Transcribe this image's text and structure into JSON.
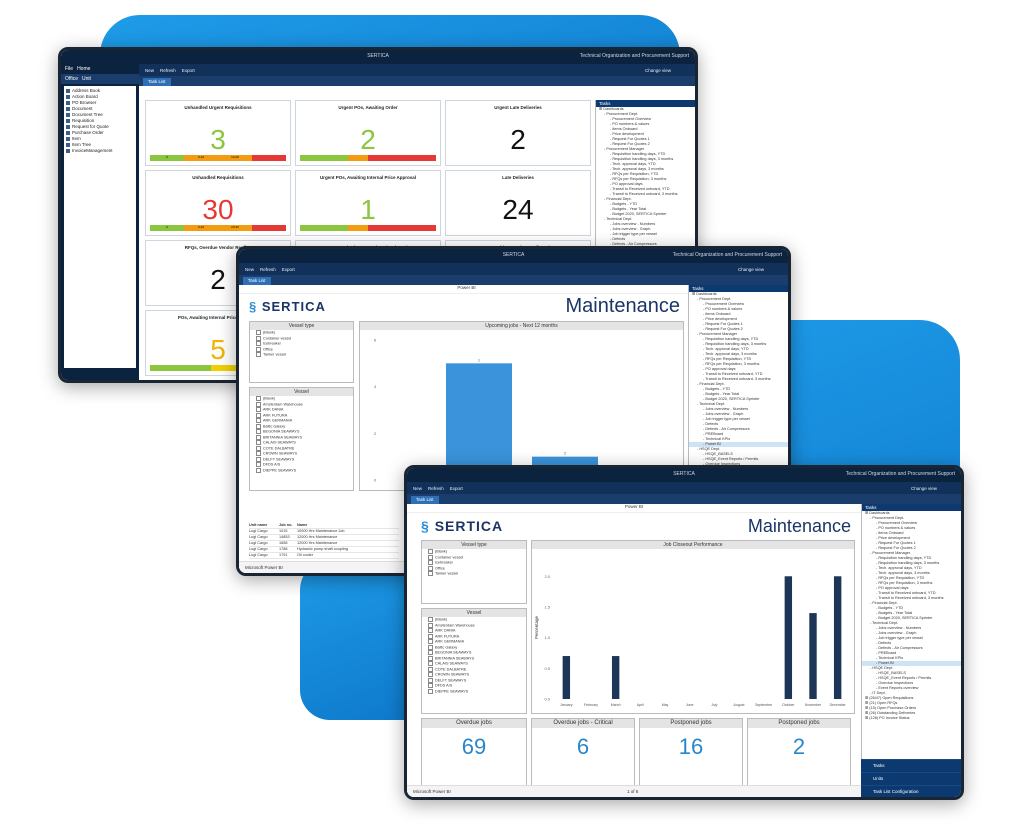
{
  "app_title": "SERTICA",
  "org_name": "Technical Organization and Procurement Support",
  "change_view": "Change view",
  "colors": {
    "dark_navy": "#0c2340",
    "accent_blue": "#2a86c9",
    "bar_navy": "#1d3557",
    "green": "#8cc63f",
    "orange": "#f39c12",
    "red": "#e53935"
  },
  "toolbar": {
    "new": "New",
    "refresh": "Refresh",
    "export": "Export"
  },
  "tab_label": "Task List",
  "w1": {
    "file_tab": "File",
    "home_tab": "Home",
    "office_tab": "Office",
    "unit_tab": "Unit",
    "nav_items": [
      "Address Book",
      "Action Board",
      "PO Browser",
      "Document",
      "Document Tree",
      "Requisition",
      "Request for Quote",
      "Purchase Order",
      "Item",
      "Item Tree",
      "InvoiceManagement"
    ],
    "cards": [
      {
        "title": "Unhandled Urgent Requisitions",
        "value": "3",
        "color": "#8cc63f",
        "bar": [
          {
            "color": "#8cc63f",
            "w": 25,
            "label": "0"
          },
          {
            "color": "#f39c12",
            "w": 25,
            "label": "0-10"
          },
          {
            "color": "#f39c12",
            "w": 25,
            "label": "10-20"
          },
          {
            "color": "#e53935",
            "w": 25,
            "label": ""
          }
        ]
      },
      {
        "title": "Urgent POs, Awaiting Order",
        "value": "2",
        "color": "#8cc63f",
        "bar": [
          {
            "color": "#8cc63f",
            "w": 35,
            "label": ""
          },
          {
            "color": "#f39c12",
            "w": 15,
            "label": ""
          },
          {
            "color": "#e53935",
            "w": 50,
            "label": ""
          }
        ]
      },
      {
        "title": "Urgent Late Deliveries",
        "value": "2",
        "color": "#111111",
        "bar": []
      },
      {
        "title": "Unhandled Requisitions",
        "value": "30",
        "color": "#e53935",
        "bar": [
          {
            "color": "#8cc63f",
            "w": 25,
            "label": "0"
          },
          {
            "color": "#f39c12",
            "w": 25,
            "label": "0-20"
          },
          {
            "color": "#f39c12",
            "w": 25,
            "label": "20-30"
          },
          {
            "color": "#e53935",
            "w": 25,
            "label": ""
          }
        ]
      },
      {
        "title": "Urgent POs, Awaiting Internal Price Approval",
        "value": "1",
        "color": "#8cc63f",
        "bar": [
          {
            "color": "#8cc63f",
            "w": 35,
            "label": ""
          },
          {
            "color": "#f39c12",
            "w": 15,
            "label": ""
          },
          {
            "color": "#e53935",
            "w": 50,
            "label": ""
          }
        ]
      },
      {
        "title": "Late Deliveries",
        "value": "24",
        "color": "#111111",
        "bar": []
      },
      {
        "title": "RFQs, Overdue Vendor Replies",
        "value": "2",
        "color": "#111111",
        "bar": []
      },
      {
        "title": "POs, Ordred - Not Recieved Onboard",
        "value": "",
        "color": "#111111",
        "bar": []
      },
      {
        "title": "POs Awaiting Vendor Confirmation",
        "value": "",
        "color": "#111111",
        "bar": []
      },
      {
        "title": "POs, Awaiting Internal Price Approval",
        "value": "5",
        "color": "#f0b400",
        "bar": [
          {
            "color": "#8cc63f",
            "w": 45,
            "label": ""
          },
          {
            "color": "#f0d000",
            "w": 20,
            "label": ""
          },
          {
            "color": "#e53935",
            "w": 35,
            "label": ""
          }
        ]
      }
    ]
  },
  "tasks": {
    "header": "Tasks",
    "items": [
      {
        "t": "Dashboards",
        "l": 0
      },
      {
        "t": "Procurement Dept.",
        "l": 1
      },
      {
        "t": "Procurement Overview",
        "l": 2
      },
      {
        "t": "PO numbers & values",
        "l": 2
      },
      {
        "t": "Items Onboard",
        "l": 2
      },
      {
        "t": "Price development",
        "l": 2
      },
      {
        "t": "Request For Quotes 1",
        "l": 2
      },
      {
        "t": "Request For Quotes 2",
        "l": 2
      },
      {
        "t": "Procurement Manager",
        "l": 1
      },
      {
        "t": "Requisition handling days, YTD",
        "l": 2
      },
      {
        "t": "Requisition handling days, 3 months",
        "l": 2
      },
      {
        "t": "Tech. approval days, YTD",
        "l": 2
      },
      {
        "t": "Tech. approval days, 3 months",
        "l": 2
      },
      {
        "t": "RFQs per Requisition, YTD",
        "l": 2
      },
      {
        "t": "RFQs per Requisition, 3 months",
        "l": 2
      },
      {
        "t": "PO approval days",
        "l": 2
      },
      {
        "t": "Transit to Received onboard, YTD",
        "l": 2
      },
      {
        "t": "Transit to Received onboard, 3 months",
        "l": 2
      },
      {
        "t": "Financial Dept.",
        "l": 1
      },
      {
        "t": "Budgets - YTD",
        "l": 2
      },
      {
        "t": "Budgets - Year Total",
        "l": 2
      },
      {
        "t": "Budget 2020, SERTICA Sprinter",
        "l": 2
      },
      {
        "t": "Technical Dept.",
        "l": 1
      },
      {
        "t": "Jobs overview - Numbers",
        "l": 2
      },
      {
        "t": "Jobs overview - Graph",
        "l": 2
      },
      {
        "t": "Job trigger type per vessel",
        "l": 2
      },
      {
        "t": "Defects",
        "l": 2
      },
      {
        "t": "Defects - Air Compressors",
        "l": 2
      },
      {
        "t": "PREBoard",
        "l": 2
      },
      {
        "t": "Technical KPIs",
        "l": 2
      },
      {
        "t": "Power BI",
        "l": 2,
        "sel": true
      },
      {
        "t": "HSQE Dept.",
        "l": 1
      },
      {
        "t": "HSQE_BASELS",
        "l": 2
      },
      {
        "t": "HSQE_Event Reports / Permits",
        "l": 2
      },
      {
        "t": "Overdue Inspections",
        "l": 2
      },
      {
        "t": "Event Reports overview",
        "l": 2
      },
      {
        "t": "IT Dept.",
        "l": 1
      },
      {
        "t": "(26/47) Open Requisitions",
        "l": 0
      },
      {
        "t": "(21) Open RFQs",
        "l": 0
      },
      {
        "t": "(15) Open Purchase Orders",
        "l": 0
      },
      {
        "t": "(26) Outstanding Deliveries",
        "l": 0
      },
      {
        "t": "(128) PO Invoice Status",
        "l": 0
      }
    ]
  },
  "pbi": {
    "header": "Power BI",
    "logo": "SERTICA",
    "title": "Maintenance",
    "vessel_type_title": "Vessel type",
    "vessel_types": [
      "(Blank)",
      "Container vessel",
      "Icebreaker",
      "Office",
      "Tanker vessel"
    ],
    "vessel_title": "Vessel",
    "vessels": [
      "(Blank)",
      "Amsterdam Warehouse",
      "ARK DANIA",
      "ARK FUTURA",
      "ARK GERMANIA",
      "Baltic Galaxy",
      "BEGONIA SEAWAYS",
      "BRITANNIA SEAWAYS",
      "CALAIS SEAWAYS",
      "COTE DALBATRE",
      "CROWN SEAWAYS",
      "DELFT SEAWAYS",
      "DFDS A/S",
      "DIEPPE SEAWAYS"
    ],
    "footer": "Microsoft Power BI",
    "page_label": "1 of 6"
  },
  "w2": {
    "chart_title": "Upcoming jobs - Next 12 months",
    "table_headers": [
      "Unit name",
      "Job no.",
      "Name"
    ],
    "table_rows": [
      [
        "Lugi Cargo",
        "1015",
        "10000 Hrs Maintenance Job"
      ],
      [
        "Lugi Cargo",
        "14853",
        "12000 Hrs Maintenance"
      ],
      [
        "Lugi Cargo",
        "1658",
        "12000 Hrs Maintenance"
      ],
      [
        "Lugi Cargo",
        "1788",
        "Hydraulic pump shaft coupling"
      ],
      [
        "Lugi Cargo",
        "1791",
        "Oil cooler"
      ]
    ]
  },
  "w3": {
    "kpis": [
      {
        "title": "Overdue jobs",
        "value": "69"
      },
      {
        "title": "Overdue jobs - Critical",
        "value": "6"
      },
      {
        "title": "Postponed jobs",
        "value": "16"
      },
      {
        "title": "Postponed jobs",
        "value": "2"
      }
    ],
    "bottom_nav": [
      "Tasks",
      "Units",
      "Task List Configuration"
    ]
  },
  "chart_data": [
    {
      "type": "bar",
      "title": "Upcoming jobs - Next 12 months",
      "categories": [
        "1",
        "2"
      ],
      "values": [
        5.0,
        1.0
      ],
      "ylim": [
        0,
        6
      ]
    },
    {
      "type": "bar",
      "title": "Job Closeout Performance",
      "ylabel": "Percentage",
      "categories": [
        "January",
        "February",
        "March",
        "April",
        "May",
        "June",
        "July",
        "August",
        "September",
        "October",
        "November",
        "December"
      ],
      "values": [
        0.7,
        0,
        0.7,
        0,
        0,
        0,
        0,
        0,
        0,
        2.0,
        1.4,
        2.0
      ],
      "ylim": [
        0,
        2.2
      ],
      "yticks": [
        "0.0",
        "0.5",
        "1.0",
        "1.5",
        "2.0"
      ]
    }
  ]
}
